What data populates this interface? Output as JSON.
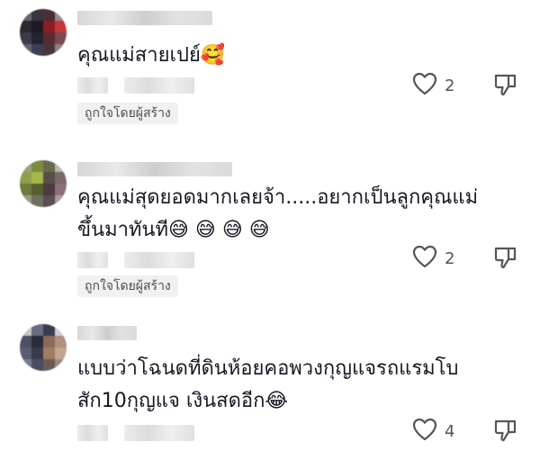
{
  "comments": [
    {
      "text_lines": [
        "คุณแม่สายเปย์🥰"
      ],
      "like_count": "2",
      "creator_badge": "ถูกใจโดยผู้สร้าง"
    },
    {
      "text_lines": [
        "คุณแม่สุดยอดมากเลยจ้า.....อยากเป็นลูกคุณแม่",
        "ขึ้นมาทันที😅 😅 😅 😅"
      ],
      "like_count": "2",
      "creator_badge": "ถูกใจโดยผู้สร้าง"
    },
    {
      "text_lines": [
        "แบบว่าโฉนดที่ดินห้อยคอพวงกุญแจรถแรมโบ",
        "สัก10กุญแจ เงินสดอีก😂"
      ],
      "like_count": "4"
    }
  ],
  "icons": {
    "like": "heart-outline-icon",
    "dislike": "thumbs-down-outline-icon"
  },
  "colors": {
    "text": "#161823",
    "badge_bg": "#f1f1f2",
    "icon": "#555555"
  }
}
